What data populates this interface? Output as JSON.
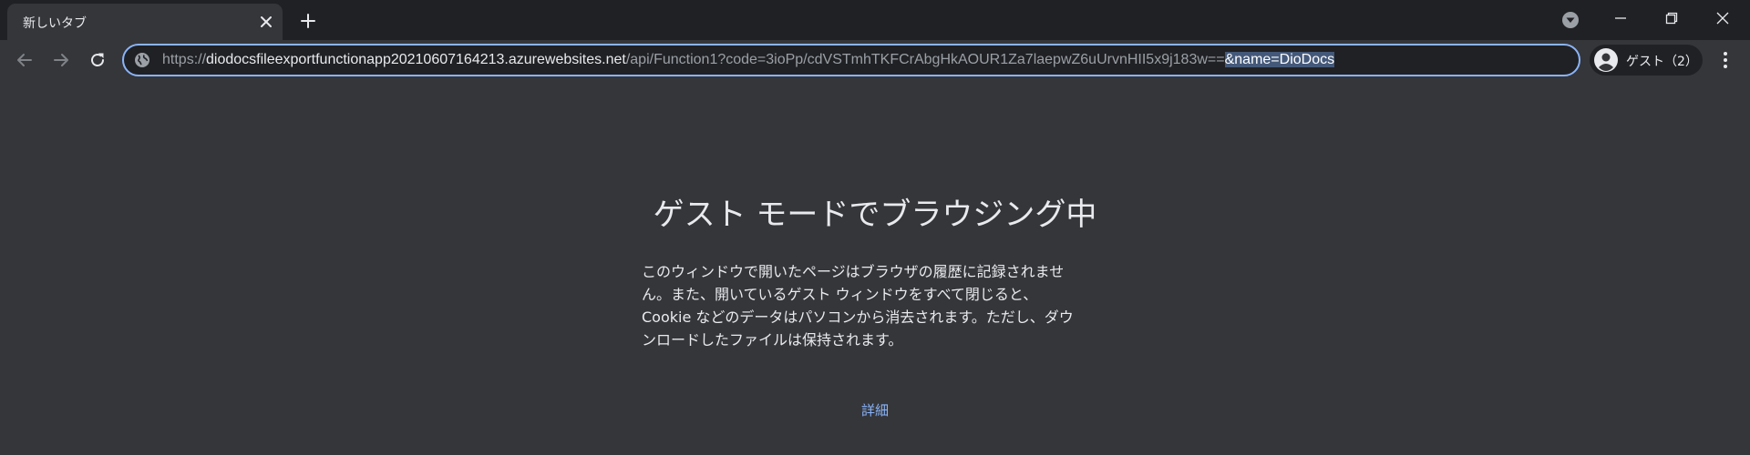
{
  "tab": {
    "title": "新しいタブ"
  },
  "toolbar": {
    "url_scheme": "https://",
    "url_host": "diodocsfileexportfunctionapp20210607164213.azurewebsites.net",
    "url_path": "/api/Function1?code=3ioPp/cdVSTmhTKFCrAbgHkAOUR1Za7laepwZ6uUrvnHII5x9j183w==",
    "url_selected": "&name=DioDocs",
    "profile_label": "ゲスト（2）"
  },
  "content": {
    "heading": "ゲスト モードでブラウジング中",
    "description_lines": [
      "このウィンドウで開いたページはブラウザの履歴に記録されませ",
      "ん。また、開いているゲスト ウィンドウをすべて閉じると、",
      "Cookie などのデータはパソコンから消去されます。ただし、ダウ",
      "ンロードしたファイルは保持されます。"
    ],
    "learn_more": "詳細"
  },
  "colors": {
    "frame": "#202124",
    "toolbar": "#35363a",
    "text": "#e8eaed",
    "muted": "#9aa0a6",
    "accent": "#8ab4f8",
    "selection": "#44597a"
  },
  "icons": {
    "tab_close": "close-icon",
    "new_tab": "plus-icon",
    "tab_search": "chevron-down-icon",
    "back": "arrow-left-icon",
    "forward": "arrow-right-icon",
    "reload": "reload-icon",
    "site_info": "globe-icon",
    "profile": "person-icon",
    "menu": "more-vertical-icon"
  }
}
